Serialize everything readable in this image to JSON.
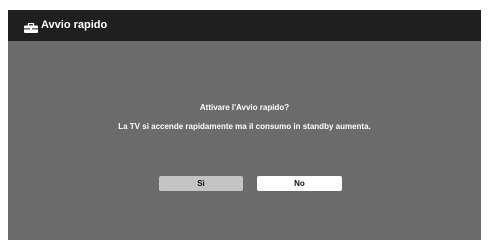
{
  "header": {
    "title": "Avvio rapido",
    "icon": "toolbox-icon"
  },
  "dialog": {
    "question": "Attivare l'Avvio rapido?",
    "description": "La TV si accende rapidamente ma il consumo in standby aumenta."
  },
  "buttons": {
    "yes_label": "Sì",
    "no_label": "No"
  },
  "colors": {
    "background": "#6b6b6b",
    "title_bar": "#1f1f1f",
    "text": "#ffffff",
    "button_selected": "#c4c4c4",
    "button_default": "#ffffff"
  }
}
